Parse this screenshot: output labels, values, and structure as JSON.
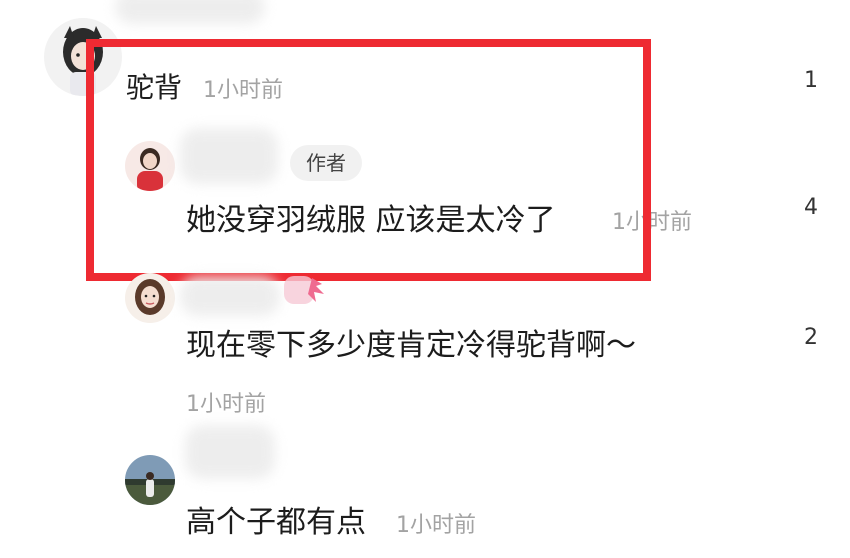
{
  "comments": [
    {
      "username": "驼背",
      "time": "1小时前",
      "likes": "1"
    },
    {
      "badge": "作者",
      "text": "她没穿羽绒服  应该是太冷了",
      "time": "1小时前",
      "likes": "4"
    },
    {
      "text": "现在零下多少度肯定冷得驼背啊～",
      "time": "1小时前",
      "likes": "2"
    },
    {
      "text": "高个子都有点",
      "time": "1小时前"
    }
  ],
  "colors": {
    "highlight": "#ee2a32",
    "timestamp": "#a3a3a3",
    "badge_bg": "#f1f1f1"
  }
}
